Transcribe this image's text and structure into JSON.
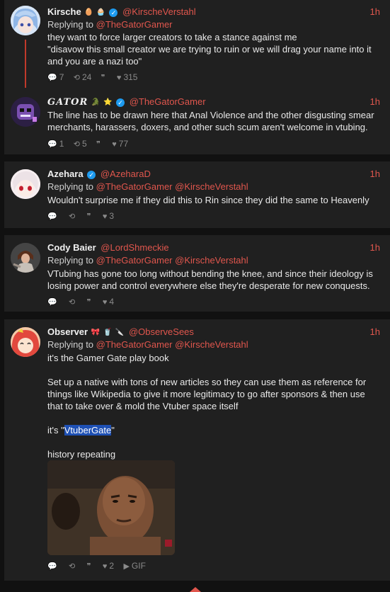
{
  "tweets": [
    {
      "name": "Kirsche",
      "emojis": [
        "🥚",
        "🧁"
      ],
      "verified": true,
      "handle": "@KirscheVerstahl",
      "time": "1h",
      "replying_label": "Replying to",
      "mentions": [
        "@TheGatorGamer"
      ],
      "text": [
        "they want to force larger creators to take a stance against me",
        "\"disavow this small creator we are trying to ruin or we will drag your name into it and you are a nazi too\""
      ],
      "stats": {
        "replies": "7",
        "retweets": "24",
        "quotes": "",
        "likes": "315"
      }
    },
    {
      "name": "GATOR",
      "emojis": [
        "🐊",
        "⭐"
      ],
      "verified": true,
      "handle": "@TheGatorGamer",
      "time": "1h",
      "text": [
        "The line has to be drawn here that Anal Violence and the other disgusting smear merchants, harassers, doxers, and other such scum aren't welcome in vtubing."
      ],
      "stats": {
        "replies": "1",
        "retweets": "5",
        "quotes": "",
        "likes": "77"
      }
    },
    {
      "name": "Azehara",
      "verified": true,
      "handle": "@AzeharaD",
      "time": "1h",
      "replying_label": "Replying to",
      "mentions": [
        "@TheGatorGamer",
        "@KirscheVerstahl"
      ],
      "text": [
        "Wouldn't surprise me if they did this to Rin since they did the same to Heavenly"
      ],
      "stats": {
        "replies": "",
        "retweets": "",
        "quotes": "",
        "likes": "3"
      }
    },
    {
      "name": "Cody Baier",
      "handle": "@LordShmeckie",
      "time": "1h",
      "replying_label": "Replying to",
      "mentions": [
        "@TheGatorGamer",
        "@KirscheVerstahl"
      ],
      "text": [
        "VTubing has gone too long without bending the knee, and since their ideology is losing power and control everywhere else they're desperate for new conquests."
      ],
      "stats": {
        "replies": "",
        "retweets": "",
        "quotes": "",
        "likes": "4"
      }
    },
    {
      "name": "Observer",
      "emojis": [
        "🎀",
        "🥤",
        "🔪"
      ],
      "handle": "@ObserveSees",
      "time": "1h",
      "replying_label": "Replying to",
      "mentions": [
        "@TheGatorGamer",
        "@KirscheVerstahl"
      ],
      "text": [
        "it's the Gamer Gate play book",
        "Set up a native with tons of new articles so they can use them as reference for things like Wikipedia to give it more legitimacy to go after sponsors & then use that to take over & mold the Vtuber space itself",
        "it's \"",
        "VtuberGate",
        "\"",
        "history repeating"
      ],
      "stats": {
        "replies": "",
        "retweets": "",
        "quotes": "",
        "likes": "2",
        "gif": "GIF"
      }
    }
  ],
  "icons": {
    "reply": "comment-icon",
    "retweet": "retweet-icon",
    "quote": "quote-icon",
    "like": "heart-icon",
    "play": "play-icon"
  },
  "colors": {
    "accent": "#e0564d",
    "verified": "#1d9bf0",
    "card": "#202020",
    "background": "#111111"
  }
}
